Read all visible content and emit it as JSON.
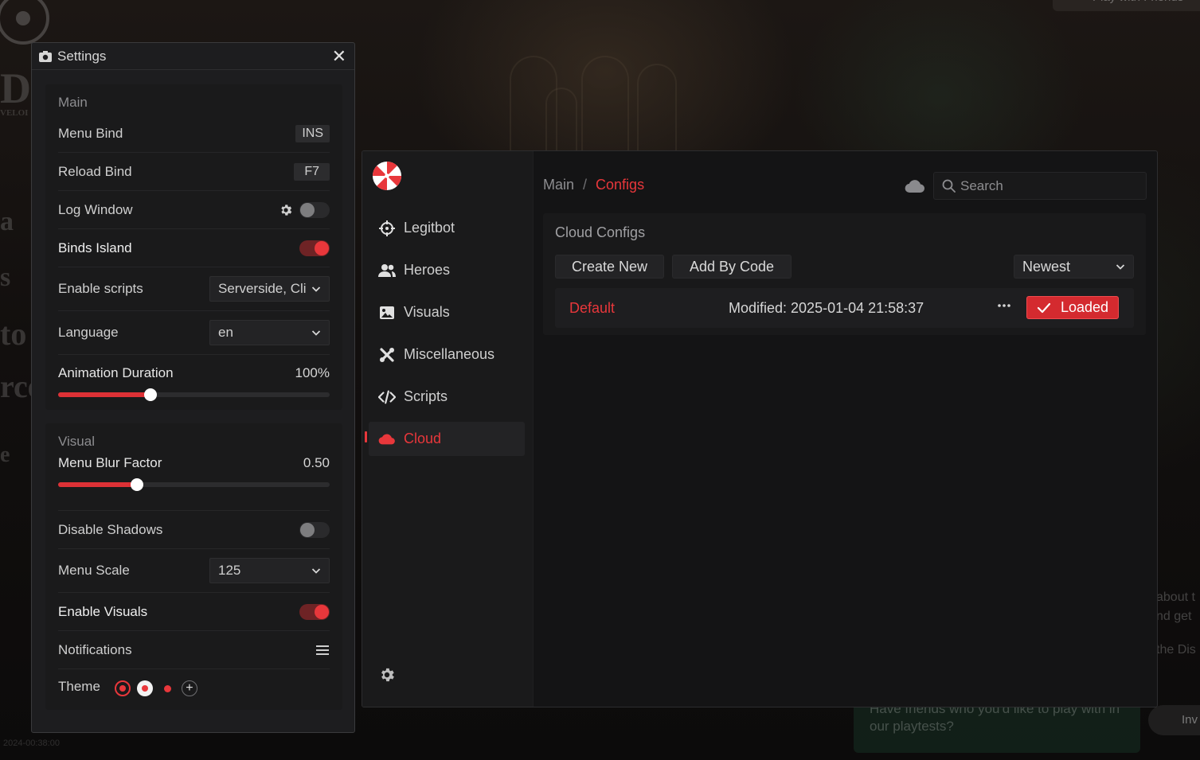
{
  "background": {
    "top_button_label": "Play with Friends",
    "side_text": [
      "about t",
      "nd get",
      "the Dis"
    ],
    "card_text": "Have friends who you'd like to play with in our playtests?",
    "invite_label": "Inv",
    "left_letters": [
      "D",
      "a",
      "s",
      "to",
      "rce",
      "e"
    ],
    "left_small": "VELOI",
    "bottom_timestamp": "2024-00:38:00"
  },
  "settings": {
    "title": "Settings",
    "close_label": "✕",
    "main_section": {
      "title": "Main",
      "menu_bind": {
        "label": "Menu Bind",
        "value": "INS"
      },
      "reload_bind": {
        "label": "Reload Bind",
        "value": "F7"
      },
      "log_window": {
        "label": "Log Window",
        "enabled": false
      },
      "binds_island": {
        "label": "Binds Island",
        "enabled": true
      },
      "enable_scripts": {
        "label": "Enable scripts",
        "value": "Serverside, Clientside"
      },
      "language": {
        "label": "Language",
        "value": "en"
      },
      "animation_duration": {
        "label": "Animation Duration",
        "value_text": "100%",
        "fraction": 0.34
      }
    },
    "visual_section": {
      "title": "Visual",
      "menu_blur_factor": {
        "label": "Menu Blur Factor",
        "value_text": "0.50",
        "fraction": 0.29
      },
      "disable_shadows": {
        "label": "Disable Shadows",
        "enabled": false
      },
      "menu_scale": {
        "label": "Menu Scale",
        "value": "125"
      },
      "enable_visuals": {
        "label": "Enable Visuals",
        "enabled": true
      },
      "notifications": {
        "label": "Notifications"
      },
      "theme": {
        "label": "Theme",
        "add_label": "+"
      }
    }
  },
  "menu": {
    "sidebar": {
      "items": [
        {
          "label": "Legitbot",
          "icon": "crosshair-icon"
        },
        {
          "label": "Heroes",
          "icon": "users-icon"
        },
        {
          "label": "Visuals",
          "icon": "image-icon"
        },
        {
          "label": "Miscellaneous",
          "icon": "tools-icon"
        },
        {
          "label": "Scripts",
          "icon": "code-icon"
        },
        {
          "label": "Cloud",
          "icon": "cloud-icon",
          "active": true
        }
      ]
    },
    "breadcrumb": {
      "root": "Main",
      "separator": "/",
      "current": "Configs"
    },
    "search": {
      "placeholder": "Search"
    },
    "cloud_configs": {
      "title": "Cloud Configs",
      "create_new_label": "Create New",
      "add_by_code_label": "Add By Code",
      "sort_value": "Newest",
      "configs": [
        {
          "name": "Default",
          "modified": "Modified: 2025-01-04 21:58:37",
          "status_label": "Loaded"
        }
      ]
    }
  },
  "colors": {
    "accent": "#e8373b",
    "panel_bg": "#1d1d1f",
    "menu_bg": "#141415"
  }
}
